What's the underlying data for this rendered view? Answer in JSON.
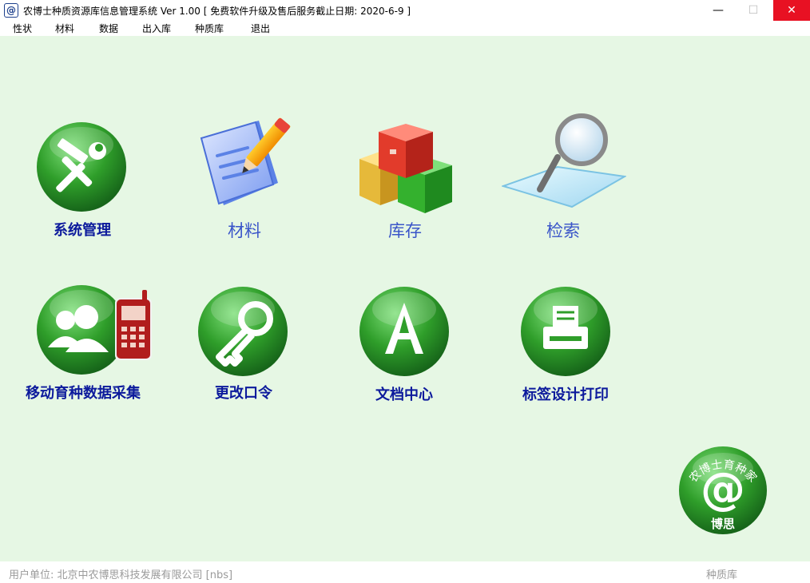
{
  "window": {
    "title": "农博士种质资源库信息管理系统 Ver 1.00 [ 免费软件升级及售后服务截止日期: 2020-6-9 ]",
    "app_icon": "@",
    "controls": {
      "minimize": "—",
      "maximize": "☐",
      "close": "✕"
    }
  },
  "menu": {
    "items": [
      {
        "label": "性状"
      },
      {
        "label": "材料"
      },
      {
        "label": "数据"
      },
      {
        "label": "出入库"
      },
      {
        "label": "种质库"
      },
      {
        "label": "退出"
      }
    ]
  },
  "tiles": {
    "system_admin": {
      "label": "系统管理",
      "icon": "tools-icon"
    },
    "materials": {
      "label": "材料",
      "icon": "document-pencil-icon"
    },
    "inventory": {
      "label": "库存",
      "icon": "boxes-icon"
    },
    "search": {
      "label": "检索",
      "icon": "magnifier-icon"
    },
    "mobile_collect": {
      "label": "移动育种数据采集",
      "icon": "users-phone-icon"
    },
    "change_password": {
      "label": "更改口令",
      "icon": "key-icon"
    },
    "documents": {
      "label": "文档中心",
      "icon": "letter-a-icon"
    },
    "label_print": {
      "label": "标签设计打印",
      "icon": "printer-icon"
    }
  },
  "logo": {
    "arc_text": "农博士育种家",
    "bottom_text": "博思",
    "symbol": "@"
  },
  "status": {
    "left": "用户单位: 北京中农博思科技发展有限公司  [nbs]",
    "right": "种质库"
  },
  "colors": {
    "background": "#e6f7e4",
    "label_blue": "#1a0aa8",
    "close_red": "#e81123",
    "icon_green": "#2f9e2a"
  }
}
